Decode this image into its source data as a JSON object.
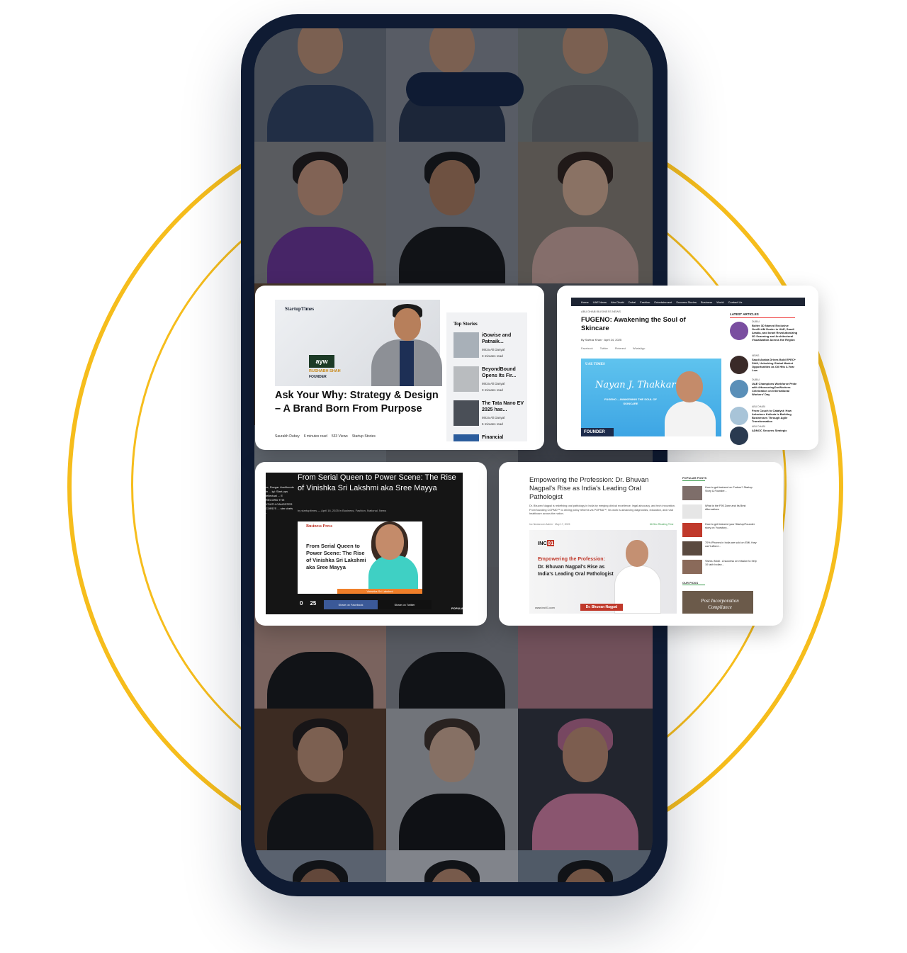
{
  "colors": {
    "ring": "#f6bd1c",
    "phone_frame": "#0f1b33",
    "accent_red": "#c0392b"
  },
  "card1": {
    "brand_a": "Startup",
    "brand_b": "Times",
    "logo_text": "ayw",
    "hero_name": "RUSHABH SHAH",
    "hero_role": "FOUNDER",
    "title": "Ask Your Why: Strategy & Design – A Brand Born From Purpose",
    "meta": [
      "Saurabh Dubey",
      "6 minutes read",
      "533 Views",
      "Startup Stories"
    ],
    "sidebar_title": "Top Stories",
    "stories": [
      {
        "title": "iGowise and Patnaik...",
        "author": "Mirza Ali Danyal",
        "read": "3 minutes read"
      },
      {
        "title": "BeyondBound Opens Its Fir...",
        "author": "Mirza Ali Danyal",
        "read": "3 minutes read"
      },
      {
        "title": "The Tata Nano EV 2025 has...",
        "author": "Mirza Ali Danyal",
        "read": "6 minutes read"
      },
      {
        "title": "Financial"
      }
    ]
  },
  "card2": {
    "nav": [
      "Home",
      "UAE News",
      "Abu Dhabi",
      "Dubai",
      "Fashion",
      "Entertainment",
      "Success Stories",
      "Business",
      "World",
      "Contact Us"
    ],
    "category": "ABU DHABI BUSINESS NEWS",
    "title": "FUGENO: Awakening the Soul of Skincare",
    "byline": "By Sarfraz Khan · April 24, 2025",
    "shares": [
      "Facebook",
      "Twitter",
      "Pinterest",
      "WhatsApp"
    ],
    "feature_logo": "UAE TIMES",
    "feature_signature": "Nayan J. Thakkar",
    "feature_sub": "FUGENO – AWAKENING THE SOUL OF SKINCARE",
    "feature_badge": "FOUNDER",
    "latest_title": "LATEST ARTICLES",
    "latest": [
      {
        "tag": "DUBAI",
        "text": "Bolter 3D Named Exclusive GeoSLAM Dealer in UAE, Saudi Arabia, and Israel Revolutionizing 3D Scanning and Architectural Visualization Across the Region"
      },
      {
        "tag": "NEWS",
        "text": "Saudi Arabia Drives Bold EPEC+ Shift, Unlocking Global Market Opportunities as Oil Hits 4-Year Low"
      },
      {
        "tag": "DUBAI",
        "text": "UAE Champions Workforce Pride with #HonouringOurWorkers Celebration on International Workers' Day"
      },
      {
        "tag": "ABU DHABI",
        "text": "From Couch to Catalyst: How Ashwinee Kolkula Is Building Businesses Through Agile Transformation"
      },
      {
        "tag": "ABU DHABI",
        "text": "ADNOC Secures Strategic"
      }
    ]
  },
  "card3": {
    "left_text": "re, Rozgar Livelihoods in ... igi: Start-ups tellectual ... E RECORD THE YOUTH GANGSTER CORD'S ... ster chefs -",
    "title": "From Serial Queen to Power Scene: The Rise of Vinishka Sri Lakshmi aka Sree Mayya",
    "byline": "by startuptimes — April 16, 2025 in Business, Fashion, National, News",
    "comments": "0",
    "image_logo": "Business Press",
    "image_title": "From Serial Queen to Power Scene: The Rise of Vinishka Sri Lakshmi aka Sree Mayya",
    "image_bar": "Vinishka Sri Lakshmi",
    "shares": "0",
    "shares_label": "SHARES",
    "views": "25",
    "views_label": "VIEWS",
    "fb": "Share on Facebook",
    "tw": "Share on Twitter",
    "popular": "POPULAR NEWS"
  },
  "card4": {
    "title": "Empowering the Profession: Dr. Bhuvan Nagpal's Rise as India's Leading Oral Pathologist",
    "desc": "Dr. Bhuvan Nagpal is redefining oral pathology in India by merging clinical excellence, legal advocacy, and tech innovation. From founding COPMD™ to driving policy reforms via POPMA™, his work is advancing diagnostics, education, and rural healthcare across the nation.",
    "meta": "Inc Newsroom Admin · May 17, 2025",
    "meta_right": "66 Sec Reading Time",
    "img_logo_a": "INC",
    "img_logo_b": "01",
    "img_t1": "Empowering the Profession:",
    "img_t2": "Dr. Bhuvan Nagpal's Rise as India's Leading Oral Pathologist",
    "img_url": "www.inc01.com",
    "img_name": "Dr. Bhuvan Nagpal",
    "popular_title": "POPULAR POSTS",
    "popular": [
      "How to get featured on Forbes? Startup Story & Founder...",
      "What is the F95 Zone and Its Best Alternatives",
      "How to get featured your Startup/Founder story on Yourstory...",
      "70% iPhones in India are sold on EMI, they can't afford...",
      "Vishnu Modi - A success on mission to help 10 lakh Indian..."
    ],
    "our_picks": "OUR PICKS",
    "pick": "Post Incorporation Compliance"
  }
}
